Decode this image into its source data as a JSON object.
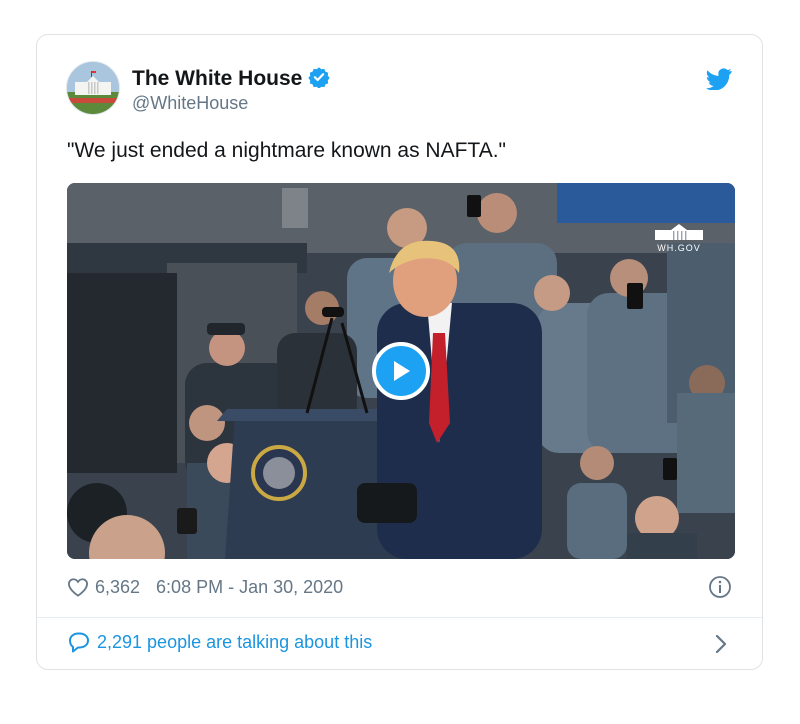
{
  "tweet": {
    "author_name": "The White House",
    "author_handle": "@WhiteHouse",
    "text": "\"We just ended a nightmare known as NAFTA.\"",
    "media_watermark": "WH.GOV",
    "likes": "6,362",
    "timestamp": "6:08 PM - Jan 30, 2020",
    "talking": "2,291 people are talking about this"
  },
  "icons": {
    "avatar": "white-house-avatar",
    "verified": "verified-badge-icon",
    "platform": "twitter-bird-icon",
    "play": "play-icon",
    "like": "heart-icon",
    "info": "info-icon",
    "reply": "speech-bubble-icon",
    "more": "chevron-right-icon"
  },
  "colors": {
    "accent": "#1da1f2",
    "link": "#1b95e0",
    "text": "#14171a",
    "muted": "#657786",
    "border": "#dfe3e6"
  }
}
